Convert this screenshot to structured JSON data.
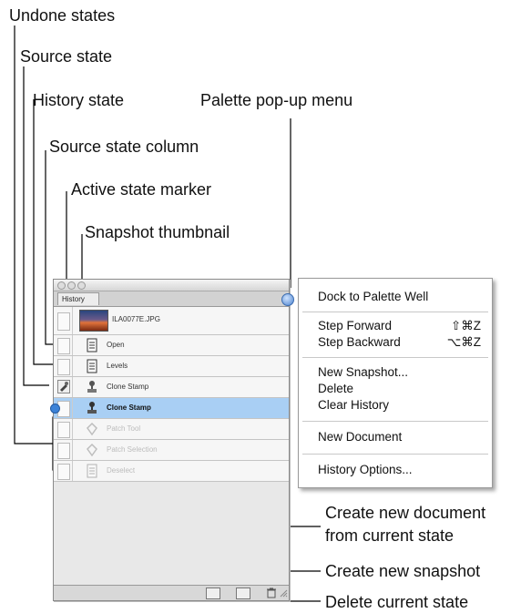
{
  "callouts": {
    "undone_states": "Undone states",
    "source_state": "Source state",
    "history_state": "History state",
    "palette_popup_menu": "Palette pop-up menu",
    "source_state_column": "Source state column",
    "active_state_marker": "Active state marker",
    "snapshot_thumbnail": "Snapshot thumbnail",
    "create_new_document_line1": "Create new document",
    "create_new_document_line2": "from current state",
    "create_new_snapshot": "Create new snapshot",
    "delete_current_state": "Delete current state"
  },
  "palette": {
    "tab_label": "History",
    "snapshot_name": "ILA0077E.JPG",
    "states": [
      {
        "label": "Open",
        "icon": "document-icon",
        "status": "normal"
      },
      {
        "label": "Levels",
        "icon": "document-icon",
        "status": "normal"
      },
      {
        "label": "Clone Stamp",
        "icon": "clone-stamp-icon",
        "status": "source"
      },
      {
        "label": "Clone Stamp",
        "icon": "clone-stamp-icon",
        "status": "active"
      },
      {
        "label": "Patch Tool",
        "icon": "patch-icon",
        "status": "undone"
      },
      {
        "label": "Patch Selection",
        "icon": "patch-icon",
        "status": "undone"
      },
      {
        "label": "Deselect",
        "icon": "document-icon",
        "status": "undone"
      }
    ]
  },
  "menu": {
    "dock": "Dock to Palette Well",
    "step_forward": "Step Forward",
    "step_forward_shortcut": "⇧⌘Z",
    "step_backward": "Step Backward",
    "step_backward_shortcut": "⌥⌘Z",
    "new_snapshot": "New Snapshot...",
    "delete": "Delete",
    "clear_history": "Clear History",
    "new_document": "New Document",
    "history_options": "History Options..."
  },
  "colors": {
    "active_row": "#a9cff4",
    "marker": "#3b82d8"
  }
}
